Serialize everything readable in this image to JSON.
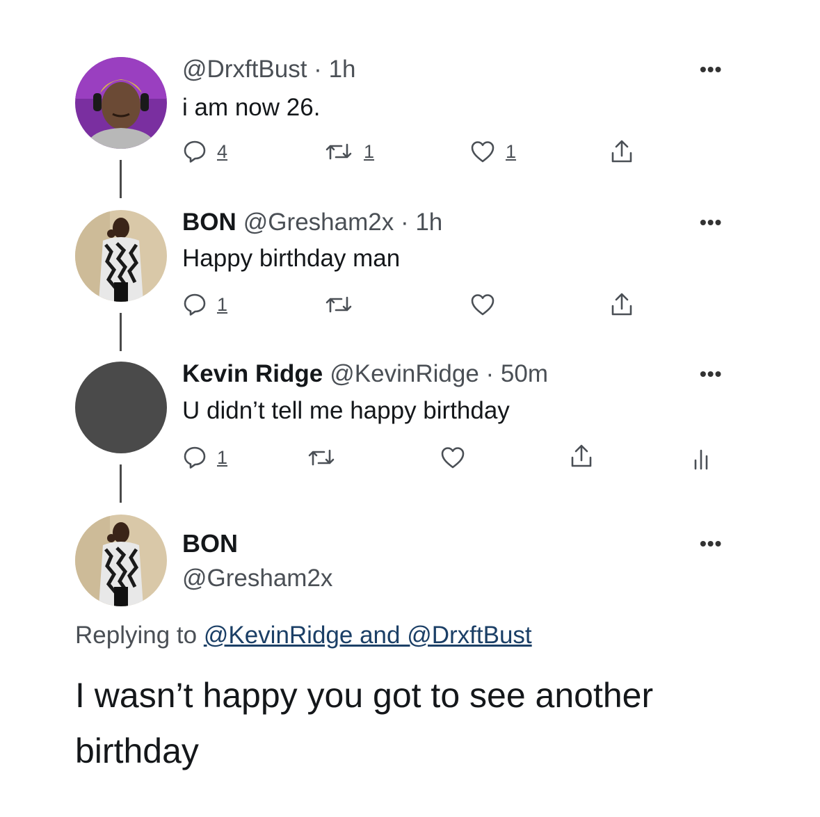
{
  "tweets": [
    {
      "name": "",
      "handle": "@DrxftBust",
      "sep": " · ",
      "time": "1h",
      "text": "i am now 26.",
      "counts": {
        "reply": "4",
        "retweet": "1",
        "like": "1"
      }
    },
    {
      "name": "BON",
      "handle": "@Gresham2x",
      "sep": " · ",
      "time": "1h",
      "text": "Happy birthday man",
      "counts": {
        "reply": "1",
        "retweet": "",
        "like": ""
      }
    },
    {
      "name": "Kevin Ridge",
      "handle": "@KevinRidge",
      "sep": " · ",
      "time": "50m",
      "text": "U didn’t tell me happy birthday",
      "counts": {
        "reply": "1",
        "retweet": "",
        "like": ""
      }
    }
  ],
  "main_tweet": {
    "name": "BON",
    "handle": "@Gresham2x",
    "replying_prefix": "Replying to ",
    "replying_users": "@KevinRidge and @DrxftBust",
    "text": "I wasn’t happy you got to see another birthday"
  },
  "icons": {
    "more": "more-icon",
    "reply": "reply-icon",
    "retweet": "retweet-icon",
    "like": "heart-icon",
    "share": "share-icon",
    "analytics": "analytics-icon"
  },
  "more_glyph": "•••",
  "colors": {
    "text": "#14171a",
    "secondary": "#4a4f55",
    "link": "#1b3f66",
    "thread_line": "#4a4a4a",
    "default_avatar": "#4a4a4a"
  }
}
